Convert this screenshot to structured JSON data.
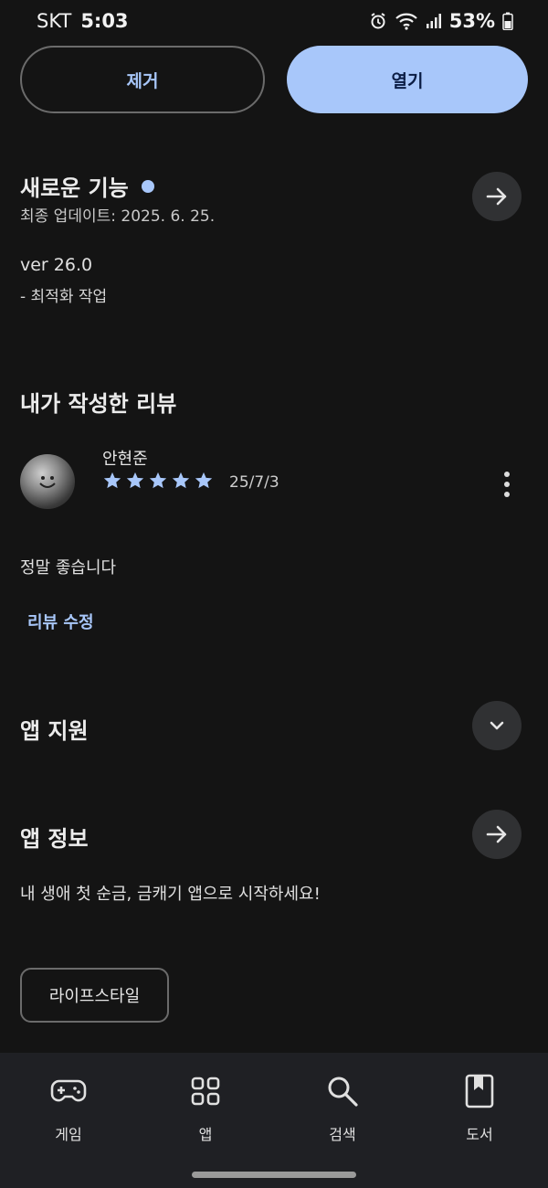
{
  "status_bar": {
    "carrier": "SKT",
    "time": "5:03",
    "battery_percent": "53%"
  },
  "actions": {
    "uninstall_label": "제거",
    "open_label": "열기"
  },
  "whats_new": {
    "title": "새로운 기능",
    "last_updated": "최종 업데이트: 2025. 6. 25.",
    "version": "ver 26.0",
    "change": "- 최적화 작업"
  },
  "my_review": {
    "title": "내가 작성한 리뷰",
    "reviewer_name": "안현준",
    "rating": 5,
    "date": "25/7/3",
    "text": "정말 좋습니다",
    "edit_label": "리뷰 수정"
  },
  "app_support": {
    "title": "앱 지원"
  },
  "app_info": {
    "title": "앱 정보",
    "description": "내 생애 첫 순금, 금캐기 앱으로 시작하세요!",
    "category_chip": "라이프스타일"
  },
  "bottom_nav": {
    "items": [
      {
        "label": "게임",
        "icon": "gamepad-icon"
      },
      {
        "label": "앱",
        "icon": "apps-grid-icon"
      },
      {
        "label": "검색",
        "icon": "search-icon"
      },
      {
        "label": "도서",
        "icon": "bookmark-book-icon"
      }
    ]
  },
  "colors": {
    "background": "#141414",
    "accent": "#a8c7fa",
    "surface": "#303133",
    "nav_background": "#1f2024"
  }
}
